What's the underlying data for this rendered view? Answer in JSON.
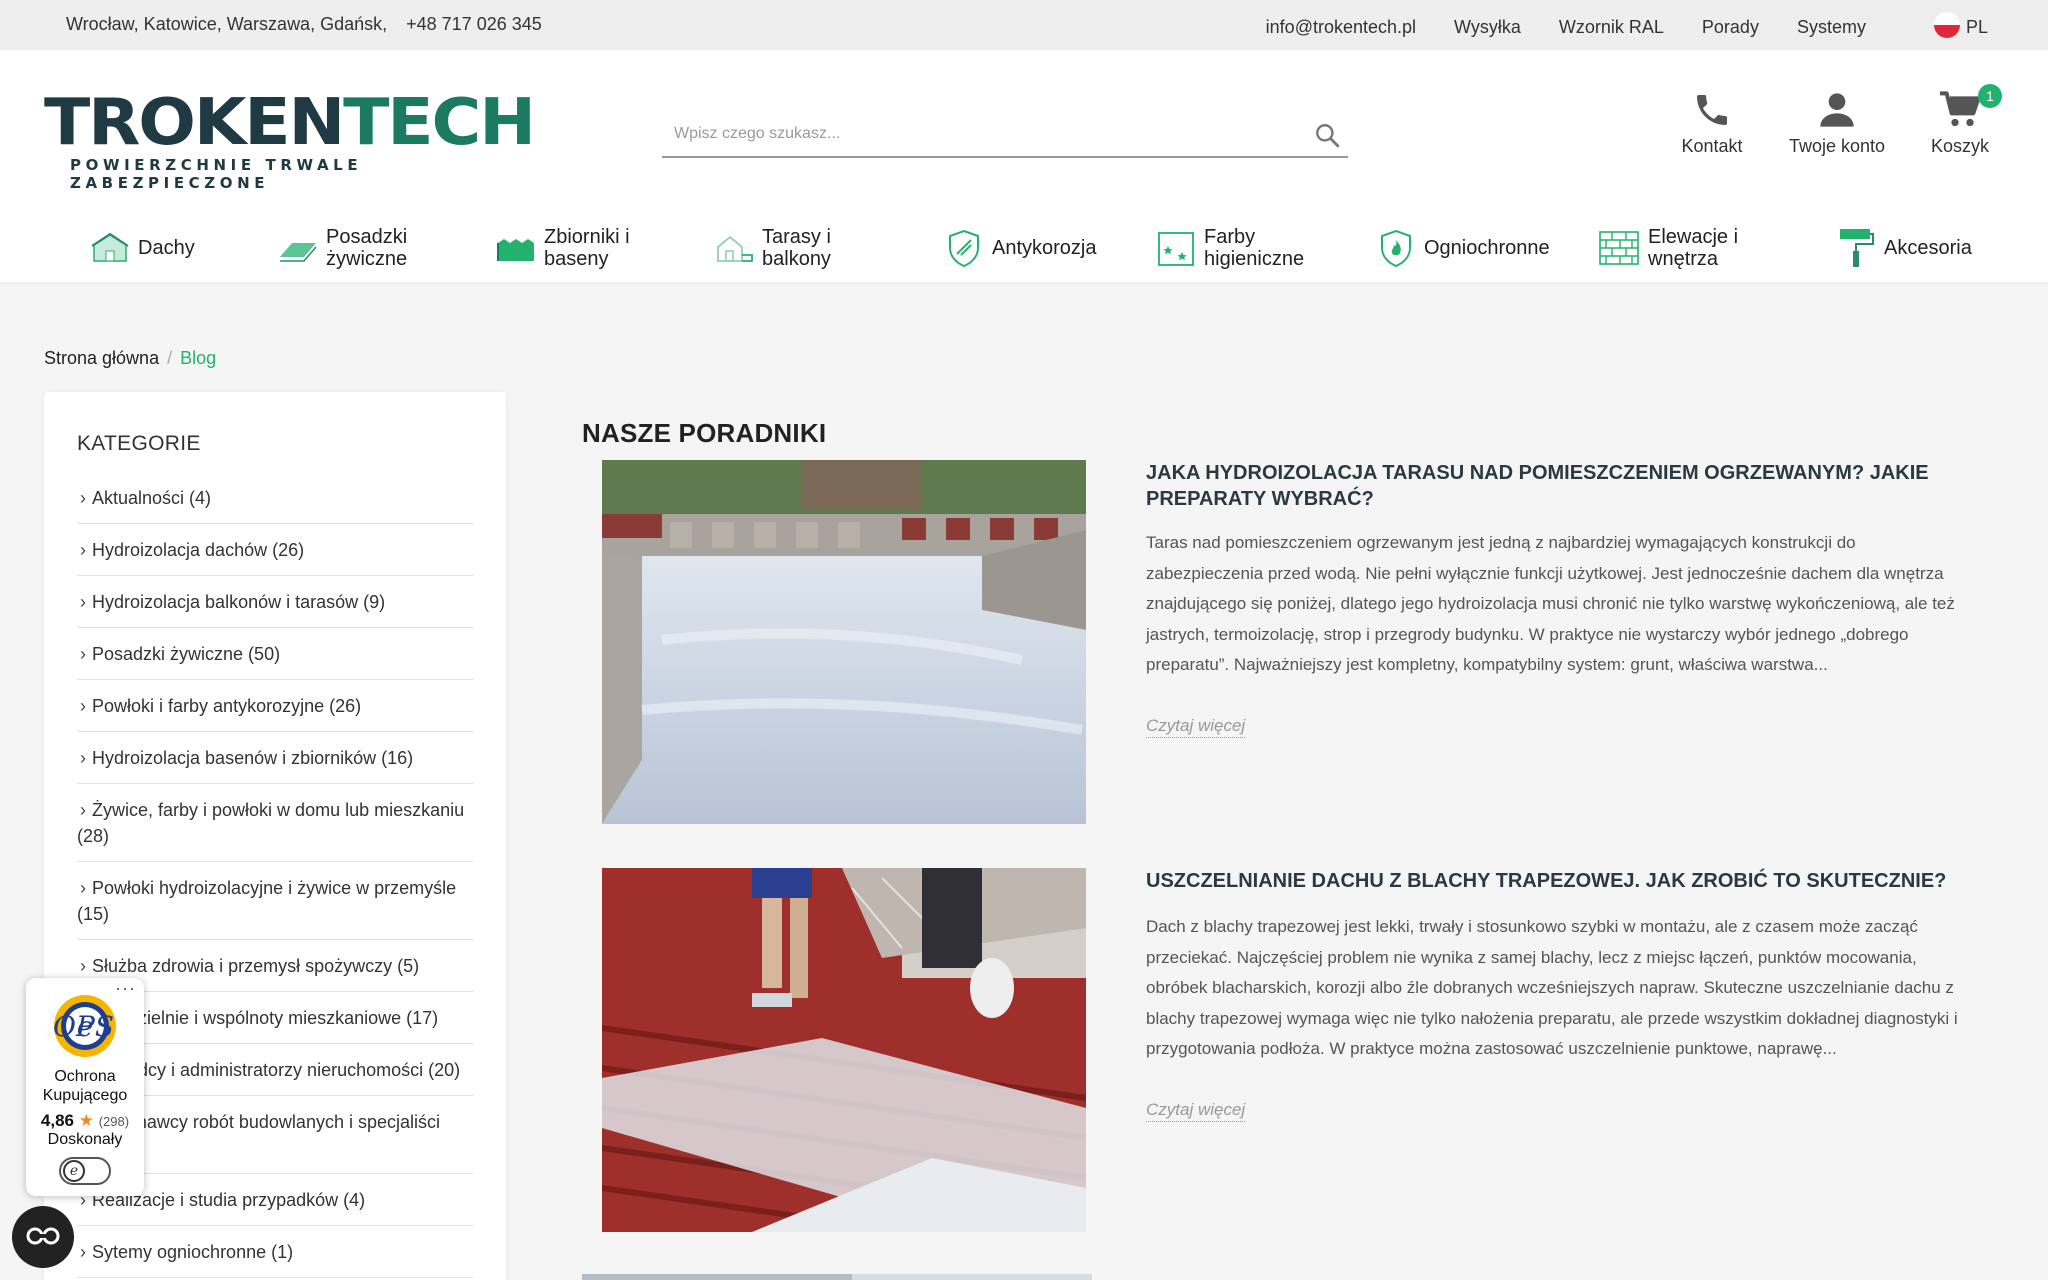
{
  "topbar": {
    "cities": "Wrocław, Katowice, Warszawa, Gdańsk,",
    "phone": "+48 717 026 345",
    "email": "info@trokentech.pl",
    "links": [
      "Wysyłka",
      "Wzornik RAL",
      "Porady",
      "Systemy"
    ],
    "lang": "PL"
  },
  "header": {
    "logo_part1": "TROKEN",
    "logo_part2": "TECH",
    "logo_tagline": "POWIERZCHNIE TRWALE ZABEZPIECZONE",
    "search_placeholder": "Wpisz czego szukasz...",
    "contact_label": "Kontakt",
    "account_label": "Twoje konto",
    "cart_label": "Koszyk",
    "cart_count": "1"
  },
  "nav": [
    {
      "line1": "Dachy",
      "line2": "",
      "icon": "roof-icon"
    },
    {
      "line1": "Posadzki",
      "line2": "żywiczne",
      "icon": "floor-icon"
    },
    {
      "line1": "Zbiorniki i",
      "line2": "baseny",
      "icon": "pool-icon"
    },
    {
      "line1": "Tarasy i",
      "line2": "balkony",
      "icon": "terrace-icon"
    },
    {
      "line1": "Antykorozja",
      "line2": "",
      "icon": "shield-icon"
    },
    {
      "line1": "Farby",
      "line2": "higieniczne",
      "icon": "hygiene-icon"
    },
    {
      "line1": "Ogniochronne",
      "line2": "",
      "icon": "fire-icon"
    },
    {
      "line1": "Elewacje i",
      "line2": "wnętrza",
      "icon": "wall-icon"
    },
    {
      "line1": "Akcesoria",
      "line2": "",
      "icon": "roller-icon"
    }
  ],
  "breadcrumb": {
    "home": "Strona główna",
    "sep": "/",
    "current": "Blog"
  },
  "sidebar": {
    "title": "KATEGORIE",
    "categories": [
      "Aktualności (4)",
      "Hydroizolacja dachów (26)",
      "Hydroizolacja balkonów i tarasów (9)",
      "Posadzki żywiczne (50)",
      "Powłoki i farby antykorozyjne (26)",
      "Hydroizolacja basenów i zbiorników (16)",
      "Żywice, farby i powłoki w domu lub mieszkaniu (28)",
      "Powłoki hydroizolacyjne i żywice w przemyśle (15)",
      "Służba zdrowia i przemysł spożywczy (5)",
      "Spółdzielnie i wspólnoty mieszkaniowe (17)",
      "Zarządcy i administratorzy nieruchomości (20)",
      "Wykonawcy robót budowlanych i specjaliści (18)",
      "Realizacje i studia przypadków (4)",
      "Sytemy ogniochronne (1)"
    ]
  },
  "main": {
    "section_title": "NASZE PORADNIKI",
    "read_more": "Czytaj więcej",
    "posts": [
      {
        "title": "JAKA HYDROIZOLACJA TARASU NAD POMIESZCZENIEM OGRZEWANYM? JAKIE PREPARATY WYBRAĆ?",
        "excerpt": "Taras nad pomieszczeniem ogrzewanym jest jedną z najbardziej wymagających konstrukcji do zabezpieczenia przed wodą. Nie pełni wyłącznie funkcji użytkowej. Jest jednocześnie dachem dla wnętrza znajdującego się poniżej, dlatego jego hydroizolacja musi chronić nie tylko warstwę wykończeniową, ale też jastrych, termoizolację, strop i przegrody budynku. W praktyce nie wystarczy wybór jednego „dobrego preparatu”. Najważniejszy jest kompletny, kompatybilny system: grunt, właściwa warstwa..."
      },
      {
        "title": "USZCZELNIANIE DACHU Z BLACHY TRAPEZOWEJ. JAK ZROBIĆ TO SKUTECZNIE?",
        "excerpt": "Dach z blachy trapezowej jest lekki, trwały i stosunkowo szybki w montażu, ale z czasem może zacząć przeciekać. Najczęściej problem nie wynika z samej blachy, lecz z miejsc łączeń, punktów mocowania, obróbek blacharskich, korozji albo źle dobranych wcześniejszych napraw. Skuteczne uszczelnianie dachu z blachy trapezowej wymaga więc nie tylko nałożenia preparatu, ale przede wszystkim dokładnej diagnostyki i przygotowania podłoża. W praktyce można zastosować uszczelnienie punktowe, naprawę..."
      }
    ]
  },
  "trust_badge": {
    "seal_text": "TRUSTED SHOPS GUARANTEE",
    "line1": "Ochrona",
    "line2": "Kupującego",
    "score": "4,86",
    "count": "(298)",
    "verdict": "Doskonały"
  },
  "colors": {
    "brand_dark": "#203a44",
    "brand_green": "#1d7a62",
    "accent": "#23b26d",
    "topbar_bg": "#eeeeee"
  }
}
